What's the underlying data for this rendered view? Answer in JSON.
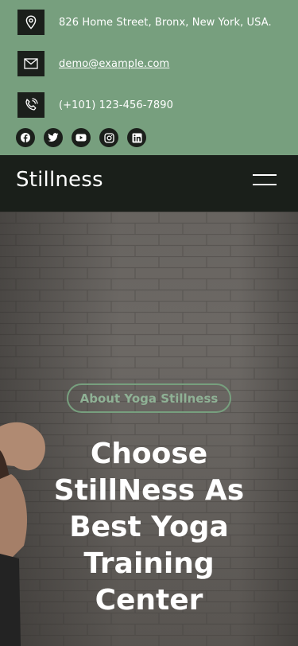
{
  "contact": {
    "address": "826 Home Street, Bronx, New York, USA.",
    "email": "demo@example.com",
    "phone": "(+101) 123-456-7890"
  },
  "socials": [
    {
      "icon": "facebook-icon"
    },
    {
      "icon": "twitter-icon"
    },
    {
      "icon": "youtube-icon"
    },
    {
      "icon": "instagram-icon"
    },
    {
      "icon": "linkedin-icon"
    }
  ],
  "nav": {
    "brand": "Stillness",
    "menu_icon": "hamburger-menu-icon"
  },
  "hero": {
    "tag": "About Yoga Stillness",
    "title_lines": [
      "Choose",
      "StillNess As",
      "Best Yoga",
      "Training",
      "Center"
    ]
  },
  "colors": {
    "accent": "#779f7e",
    "dark": "#1b1f1b",
    "text_light": "#ffffff"
  }
}
